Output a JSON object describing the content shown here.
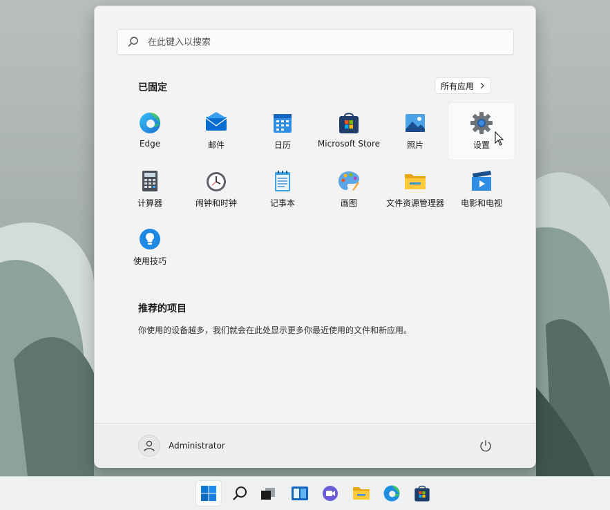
{
  "search": {
    "placeholder": "在此键入以搜索"
  },
  "pinned": {
    "title": "已固定",
    "all_apps_label": "所有应用",
    "apps": [
      {
        "label": "Edge",
        "icon": "edge-icon"
      },
      {
        "label": "邮件",
        "icon": "mail-icon"
      },
      {
        "label": "日历",
        "icon": "calendar-icon"
      },
      {
        "label": "Microsoft Store",
        "icon": "store-icon"
      },
      {
        "label": "照片",
        "icon": "photos-icon"
      },
      {
        "label": "设置",
        "icon": "gear-icon"
      },
      {
        "label": "计算器",
        "icon": "calculator-icon"
      },
      {
        "label": "闹钟和时钟",
        "icon": "clock-icon"
      },
      {
        "label": "记事本",
        "icon": "notepad-icon"
      },
      {
        "label": "画图",
        "icon": "paint-icon"
      },
      {
        "label": "文件资源管理器",
        "icon": "folder-icon"
      },
      {
        "label": "电影和电视",
        "icon": "movies-icon"
      },
      {
        "label": "使用技巧",
        "icon": "tips-icon"
      }
    ]
  },
  "recommended": {
    "title": "推荐的项目",
    "text": "你使用的设备越多，我们就会在此处显示更多你最近使用的文件和新应用。"
  },
  "footer": {
    "username": "Administrator"
  },
  "taskbar": {
    "items": [
      "start-icon",
      "search-icon",
      "task-view-icon",
      "widgets-icon",
      "chat-icon",
      "file-explorer-icon",
      "edge-icon",
      "store-icon"
    ]
  },
  "colors": {
    "accent": "#0078d4",
    "menu_bg": "#f3f3f3",
    "taskbar_bg": "#eef0f2"
  }
}
